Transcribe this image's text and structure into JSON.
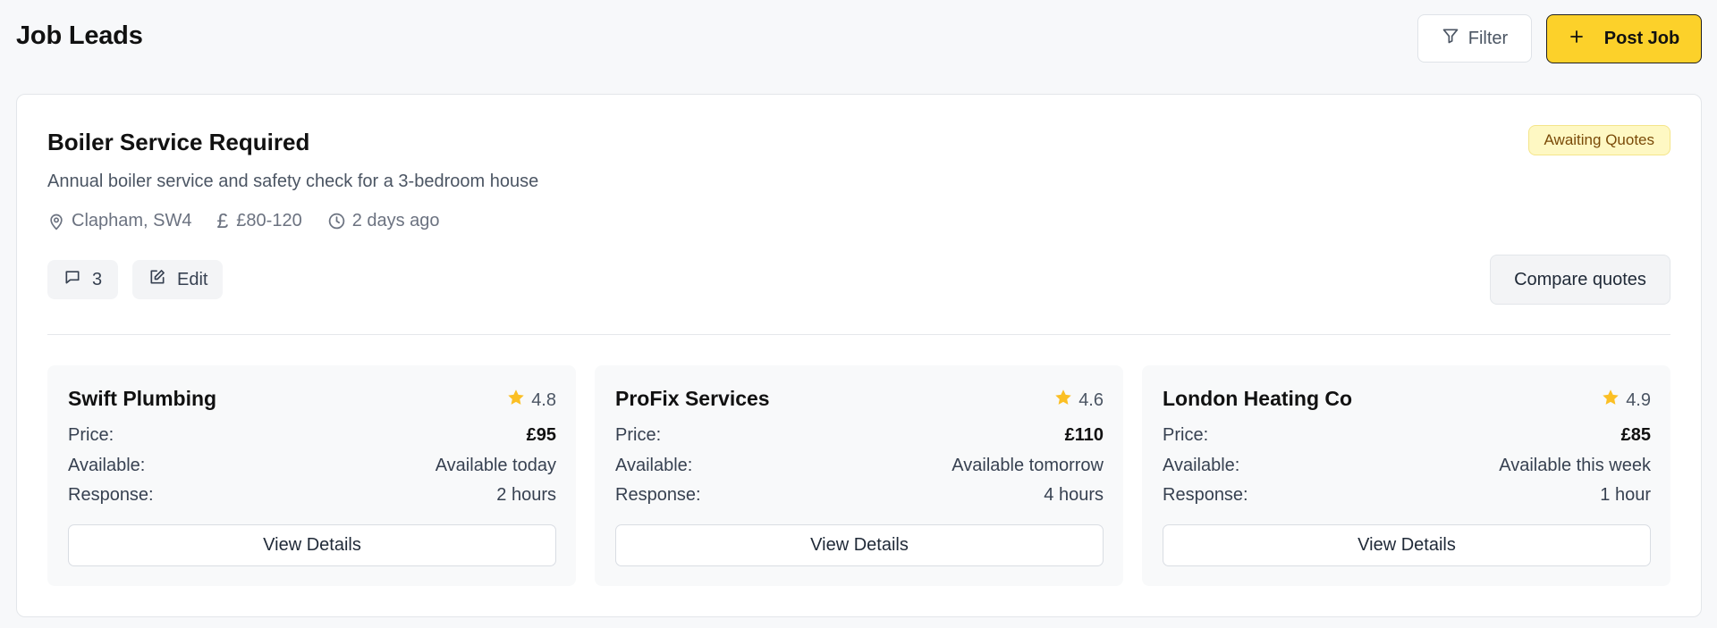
{
  "header": {
    "title": "Job Leads",
    "filter_label": "Filter",
    "post_job_label": "Post Job"
  },
  "job": {
    "title": "Boiler Service Required",
    "status": "Awaiting Quotes",
    "description": "Annual boiler service and safety check for a 3-bedroom house",
    "location": "Clapham, SW4",
    "budget_symbol": "£",
    "budget": "£80-120",
    "posted": "2 days ago",
    "comments_count": "3",
    "edit_label": "Edit",
    "compare_label": "Compare quotes"
  },
  "quotes": [
    {
      "name": "Swift Plumbing",
      "rating": "4.8",
      "price_label": "Price:",
      "price": "£95",
      "available_label": "Available:",
      "available": "Available today",
      "response_label": "Response:",
      "response": "2 hours",
      "details_label": "View Details"
    },
    {
      "name": "ProFix Services",
      "rating": "4.6",
      "price_label": "Price:",
      "price": "£110",
      "available_label": "Available:",
      "available": "Available tomorrow",
      "response_label": "Response:",
      "response": "4 hours",
      "details_label": "View Details"
    },
    {
      "name": "London Heating Co",
      "rating": "4.9",
      "price_label": "Price:",
      "price": "£85",
      "available_label": "Available:",
      "available": "Available this week",
      "response_label": "Response:",
      "response": "1 hour",
      "details_label": "View Details"
    }
  ],
  "icons": {
    "filter": "filter-icon",
    "plus": "plus-icon",
    "location": "map-pin-icon",
    "budget": "pound-icon",
    "time": "clock-icon",
    "comments": "message-square-icon",
    "edit": "edit-icon",
    "rating": "star-icon"
  },
  "colors": {
    "accent": "#fcd12a",
    "star": "#fbbf24",
    "badge_bg": "#fef8c3",
    "badge_text": "#7a4a08"
  }
}
